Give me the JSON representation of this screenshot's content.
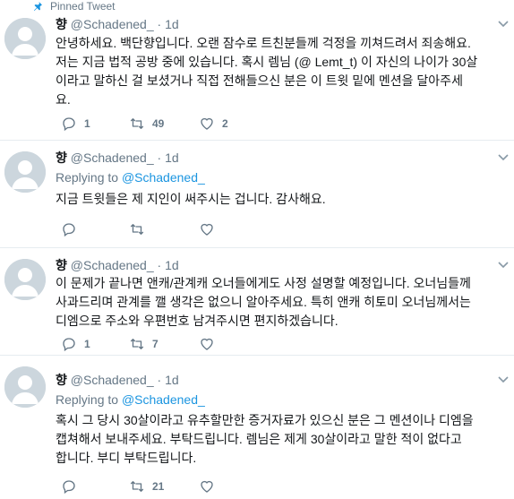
{
  "pinned_label": "Pinned Tweet",
  "tweets": [
    {
      "name": "향",
      "handle": "@Schadened_",
      "dot": "·",
      "time": "1d",
      "body": "안녕하세요. 백단향입니다. 오랜 잠수로 트친분들께 걱정을 끼쳐드려서 죄송해요.\n저는 지금 법적 공방 중에 있습니다. 혹시 렘님 (@ Lemt_t) 이 자신의 나이가 30살\n이라고 말하신 걸 보셨거나 직접 전해들으신 분은 이 트윗 밑에 멘션을 달아주세\n요.",
      "replies": "1",
      "retweets": "49",
      "likes": "2"
    },
    {
      "name": "향",
      "handle": "@Schadened_",
      "dot": "·",
      "time": "1d",
      "replying_prefix": "Replying to ",
      "replying_to": "@Schadened_",
      "body": "지금 트윗들은 제 지인이 써주시는 겁니다. 감사해요.",
      "replies": "",
      "retweets": "",
      "likes": ""
    },
    {
      "name": "향",
      "handle": "@Schadened_",
      "dot": "·",
      "time": "1d",
      "body": "이 문제가 끝나면 앤캐/관계캐 오너들에게도 사정 설명할 예정입니다. 오너님들께\n사과드리며 관계를 깰 생각은 없으니 알아주세요. 특히 앤캐 히토미 오너님께서는\n디엠으로 주소와 우편번호 남겨주시면 편지하겠습니다.",
      "replies": "1",
      "retweets": "7",
      "likes": ""
    },
    {
      "name": "향",
      "handle": "@Schadened_",
      "dot": "·",
      "time": "1d",
      "replying_prefix": "Replying to ",
      "replying_to": "@Schadened_",
      "body": "혹시 그 당시 30살이라고 유추할만한 증거자료가 있으신 분은 그 멘션이나 디엠을\n캡쳐해서 보내주세요. 부탁드립니다. 렘님은 제게 30살이라고 말한 적이 없다고\n합니다. 부디 부탁드립니다.",
      "replies": "",
      "retweets": "21",
      "likes": ""
    }
  ],
  "icons": {
    "pin": "pin-icon",
    "reply": "reply-icon",
    "retweet": "retweet-icon",
    "like": "heart-icon",
    "caret": "chevron-down-icon",
    "avatar": "default-avatar"
  },
  "colors": {
    "text": "#14171a",
    "muted": "#657786",
    "link": "#1b95e0",
    "avatar_bg": "#ccd6dd",
    "divider": "#e6ecf0"
  }
}
